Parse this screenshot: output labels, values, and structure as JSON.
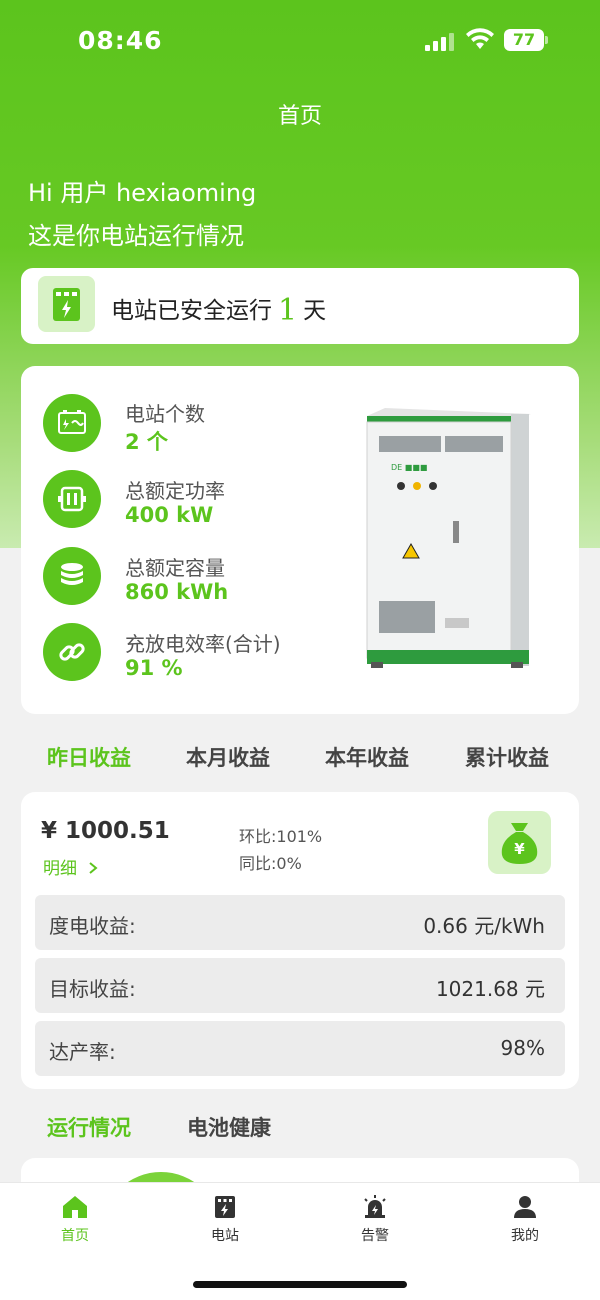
{
  "status_bar": {
    "time": "08:46",
    "battery": "77"
  },
  "nav": {
    "title": "首页"
  },
  "greeting": {
    "line1": "Hi 用户 hexiaoming",
    "line2": "这是你电站运行情况"
  },
  "safe_run": {
    "prefix": "电站已安全运行",
    "days": "1",
    "suffix": "天"
  },
  "stats": [
    {
      "label": "电站个数",
      "value": "2 个",
      "icon": "battery-cabinet-icon"
    },
    {
      "label": "总额定功率",
      "value": "400 kW",
      "icon": "power-module-icon"
    },
    {
      "label": "总额定容量",
      "value": "860 kWh",
      "icon": "capacity-stack-icon"
    },
    {
      "label": "充放电效率(合计)",
      "value": "91 %",
      "icon": "link-icon"
    }
  ],
  "income_tabs": [
    "昨日收益",
    "本月收益",
    "本年收益",
    "累计收益"
  ],
  "income": {
    "amount": "¥ 1000.51",
    "detail": "明细",
    "mom": "环比:101%",
    "yoy": "同比:0%",
    "rows": [
      {
        "label": "度电收益:",
        "value": "0.66 元/kWh"
      },
      {
        "label": "目标收益:",
        "value": "1021.68 元"
      },
      {
        "label": "达产率:",
        "value": "98%"
      }
    ]
  },
  "run_tabs": [
    "运行情况",
    "电池健康"
  ],
  "tabbar": [
    {
      "label": "首页",
      "icon": "home-icon"
    },
    {
      "label": "电站",
      "icon": "station-icon"
    },
    {
      "label": "告警",
      "icon": "alarm-icon"
    },
    {
      "label": "我的",
      "icon": "user-icon"
    }
  ],
  "colors": {
    "brand": "#5cc41d",
    "brand_light": "#d8f2c6"
  }
}
